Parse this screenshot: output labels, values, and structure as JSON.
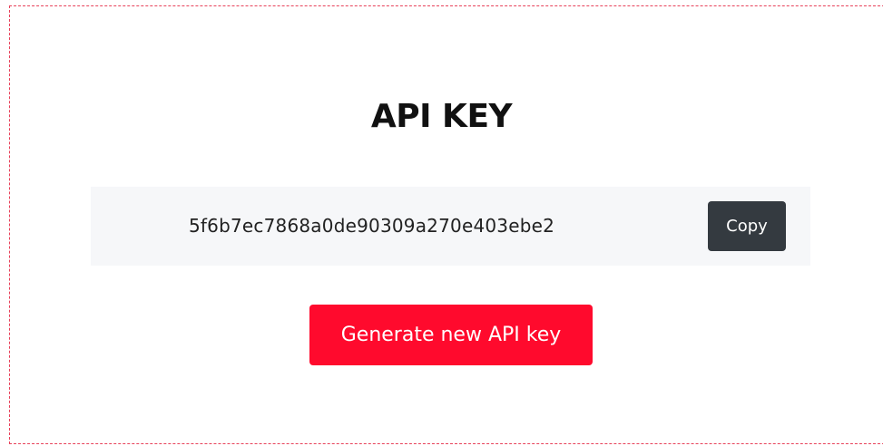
{
  "page": {
    "title": "API KEY"
  },
  "api_key": {
    "value": "5f6b7ec7868a0de90309a270e403ebe2",
    "copy_label": "Copy"
  },
  "actions": {
    "generate_label": "Generate new API key"
  },
  "colors": {
    "frame_border": "#e8415a",
    "key_box_background": "#f6f7f9",
    "copy_button": "#343a40",
    "generate_button": "#ff0a2d"
  }
}
